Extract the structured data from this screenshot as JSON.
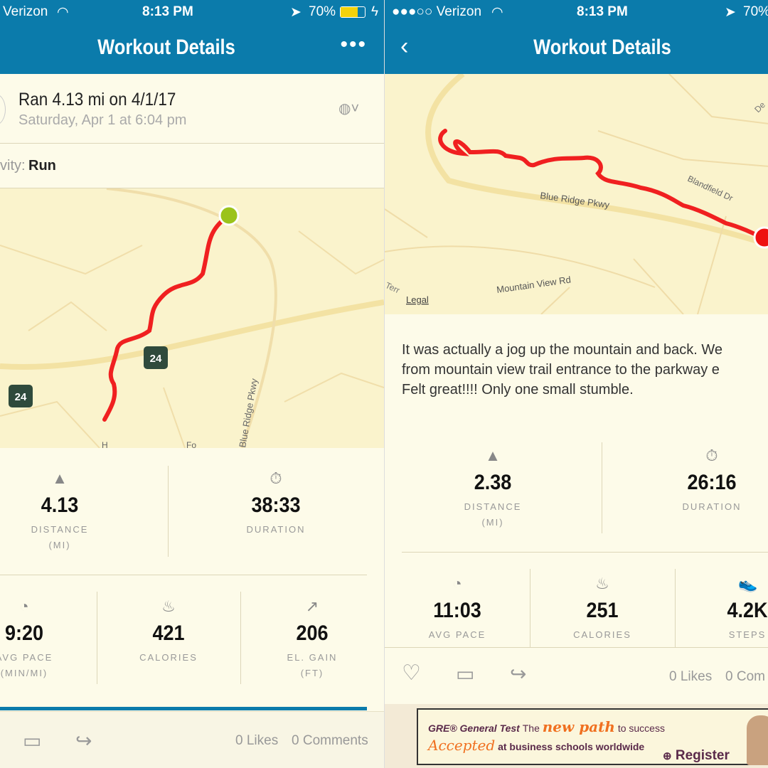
{
  "colors": {
    "header": "#0b7bab",
    "route": "#f02020",
    "start": "#9bc31c",
    "end": "#ee1111",
    "background": "#fdfbe9"
  },
  "left": {
    "status": {
      "carrier": "Verizon",
      "time": "8:13 PM",
      "battery": "70%"
    },
    "header": {
      "title": "Workout Details",
      "more_icon": "ellipsis"
    },
    "workout": {
      "title": "Ran 4.13 mi on 4/1/17",
      "subtitle": "Saturday, Apr 1 at 6:04 pm",
      "privacy_icon": "globe"
    },
    "activity": {
      "label": "vity:",
      "value": "Run"
    },
    "map": {
      "labels": [
        "24",
        "24",
        "Blue Ridge Pkwy",
        "H",
        "Fo"
      ]
    },
    "stats": [
      {
        "icon": "road",
        "value": "4.13",
        "label": "DISTANCE",
        "unit": "(MI)"
      },
      {
        "icon": "stopwatch",
        "value": "38:33",
        "label": "DURATION",
        "unit": ""
      },
      {
        "icon": "gauge",
        "value": "9:20",
        "label": "AVG PACE",
        "unit": "(MIN/MI)"
      },
      {
        "icon": "flame",
        "value": "421",
        "label": "CALORIES",
        "unit": ""
      },
      {
        "icon": "arrow-up-right",
        "value": "206",
        "label": "EL. GAIN",
        "unit": "(FT)"
      }
    ],
    "footer": {
      "likes": "0 Likes",
      "comments": "0 Comments"
    }
  },
  "right": {
    "status": {
      "carrier": "●●●○○ Verizon",
      "time": "8:13 PM",
      "battery": "70%"
    },
    "header": {
      "title": "Workout Details"
    },
    "map": {
      "labels": [
        "Blue Ridge Pkwy",
        "Blandfield Dr",
        "Mountain View Rd",
        "Legal",
        "Terr",
        "De"
      ]
    },
    "description": "It was actually a jog up the mountain and back. We went from mountain view trail entrance to the parkway entrance. Felt great!!!! Only one small stumble.",
    "description_lines": [
      "It was actually a jog up the mountain and back. We",
      "from mountain view trail entrance to the parkway e",
      "Felt great!!!! Only one small stumble."
    ],
    "stats": [
      {
        "icon": "road",
        "value": "2.38",
        "label": "DISTANCE",
        "unit": "(MI)"
      },
      {
        "icon": "stopwatch",
        "value": "26:16",
        "label": "DURATION",
        "unit": ""
      },
      {
        "icon": "gauge",
        "value": "11:03",
        "label": "AVG PACE",
        "unit": ""
      },
      {
        "icon": "flame",
        "value": "251",
        "label": "CALORIES",
        "unit": ""
      },
      {
        "icon": "shoe",
        "value": "4.2K",
        "label": "STEPS",
        "unit": ""
      }
    ],
    "footer": {
      "likes": "0 Likes",
      "comments": "0 Com"
    },
    "ad": {
      "brand": "GRE® General Test",
      "line1a": "The",
      "line1b": "new path",
      "line1c": "to success",
      "line2a": "Accepted",
      "line2b": "at business schools worldwide",
      "cta": "Register"
    }
  }
}
